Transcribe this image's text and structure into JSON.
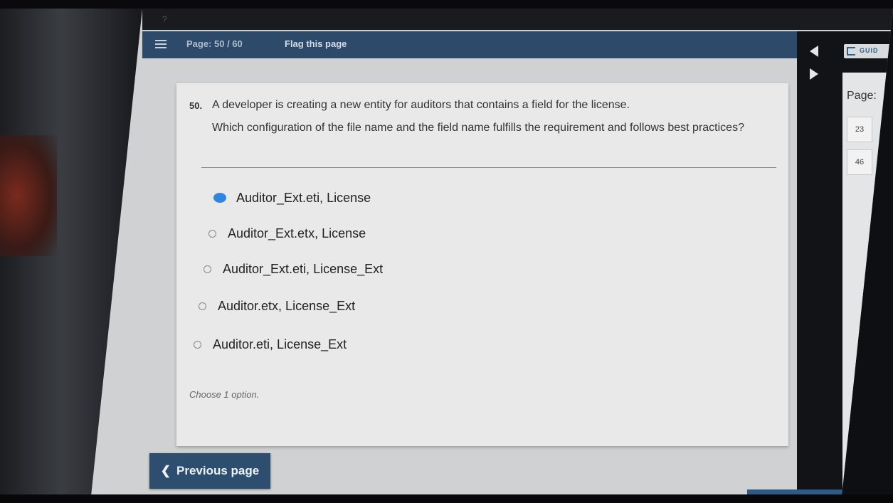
{
  "header": {
    "page_label": "Page: 50 / 60",
    "flag_label": "Flag this page"
  },
  "question": {
    "number": "50.",
    "text_line1": "A developer is creating a new entity for auditors that contains a field for the license.",
    "text_line2": "Which configuration of the file name and the field name fulfills the requirement and follows best practices?",
    "options": [
      {
        "label": "Auditor_Ext.eti, License",
        "selected": true
      },
      {
        "label": "Auditor_Ext.etx, License",
        "selected": false
      },
      {
        "label": "Auditor_Ext.eti, License_Ext",
        "selected": false
      },
      {
        "label": "Auditor.etx, License_Ext",
        "selected": false
      },
      {
        "label": "Auditor.eti, License_Ext",
        "selected": false
      }
    ],
    "hint": "Choose 1 option."
  },
  "side_panel": {
    "brand": "GUID",
    "title": "Page:",
    "pages": [
      "23",
      "46"
    ]
  },
  "footer": {
    "prev_label": "Previous page"
  },
  "colors": {
    "header": "#2d4a6b",
    "selected_radio": "#2f86e0",
    "button": "#2e4e6f"
  }
}
